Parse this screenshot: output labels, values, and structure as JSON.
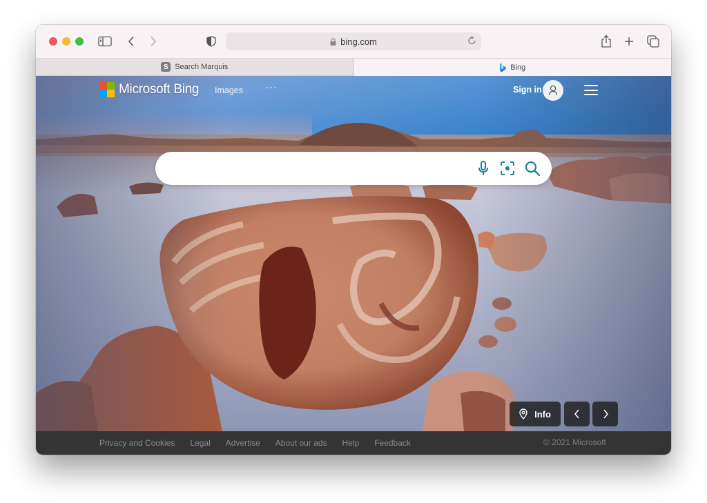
{
  "browser": {
    "window_controls": [
      "close",
      "minimize",
      "maximize"
    ],
    "toolbar_icons": {
      "sidebar": "sidebar-icon",
      "back": "chevron-left-icon",
      "forward": "chevron-right-icon",
      "privacy": "shield-icon",
      "share": "share-icon",
      "new_tab": "plus-icon",
      "tab_overview": "tabs-icon"
    },
    "address_bar": {
      "url": "bing.com",
      "secure_icon": "lock-icon",
      "reload_icon": "reload-icon"
    },
    "tabs": [
      {
        "label": "Search Marquis",
        "favicon_letter": "S",
        "active": false
      },
      {
        "label": "Bing",
        "favicon": "bing-logo",
        "active": true
      }
    ]
  },
  "bing": {
    "brand": "Microsoft Bing",
    "logo_colors": [
      "#f25022",
      "#7fba00",
      "#00a4ef",
      "#ffb900"
    ],
    "nav": {
      "images": "Images",
      "more": "···"
    },
    "sign_in": "Sign in",
    "search": {
      "value": "",
      "placeholder": "",
      "icons": [
        "microphone-icon",
        "visual-search-icon",
        "search-icon"
      ],
      "accent": "#1a7fa3"
    },
    "image_controls": {
      "info": "Info",
      "prev_icon": "chevron-left-icon",
      "next_icon": "chevron-right-icon"
    },
    "footer": {
      "links": [
        "Privacy and Cookies",
        "Legal",
        "Advertise",
        "About our ads",
        "Help",
        "Feedback"
      ],
      "copyright": "© 2021 Microsoft"
    }
  }
}
